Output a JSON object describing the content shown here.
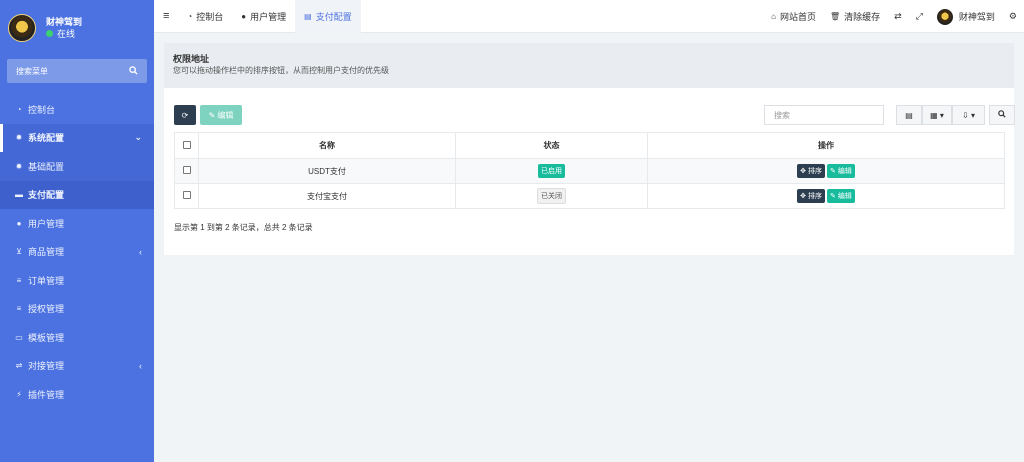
{
  "sidebar": {
    "user_name": "财神驾到",
    "status": "在线",
    "search_label": "搜索菜单",
    "items": [
      {
        "label": "控制台",
        "icon": "dashboard-icon"
      },
      {
        "label": "系统配置",
        "icon": "gear-icon"
      },
      {
        "label": "基础配置",
        "icon": "gear-icon"
      },
      {
        "label": "支付配置",
        "icon": "card-icon"
      },
      {
        "label": "用户管理",
        "icon": "user-icon"
      },
      {
        "label": "商品管理",
        "icon": "cart-icon"
      },
      {
        "label": "订单管理",
        "icon": "list-icon"
      },
      {
        "label": "授权管理",
        "icon": "list-icon"
      },
      {
        "label": "模板管理",
        "icon": "template-icon"
      },
      {
        "label": "对接管理",
        "icon": "sliders-icon"
      },
      {
        "label": "插件管理",
        "icon": "plug-icon"
      }
    ]
  },
  "topbar": {
    "tabs": [
      {
        "label": "控制台"
      },
      {
        "label": "用户管理"
      },
      {
        "label": "支付配置"
      }
    ],
    "home_label": "网站首页",
    "clear_cache_label": "清除缓存",
    "user_name": "财神驾到"
  },
  "panel": {
    "title": "权限地址",
    "desc": "您可以拖动操作栏中的排序按钮，从而控制用户支付的优先级"
  },
  "toolbar": {
    "edit_label": "编辑",
    "search_placeholder": "搜索"
  },
  "table": {
    "headers": [
      "名称",
      "状态",
      "操作"
    ],
    "rows": [
      {
        "name": "USDT支付",
        "status": "已启用",
        "sort": "排序",
        "edit": "编辑"
      },
      {
        "name": "支付宝支付",
        "status": "已关闭",
        "sort": "排序",
        "edit": "编辑"
      }
    ]
  },
  "footer": "显示第 1 到第 2 条记录，总共 2 条记录"
}
